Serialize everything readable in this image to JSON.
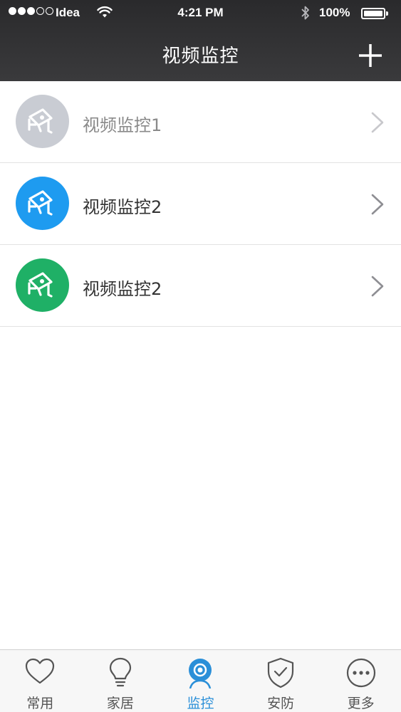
{
  "status_bar": {
    "carrier": "Idea",
    "time": "4:21 PM",
    "battery": "100%",
    "signal_bars_filled": 3,
    "signal_bars_total": 5
  },
  "nav": {
    "title": "视频监控",
    "add_icon": "plus-icon"
  },
  "cameras": [
    {
      "label": "视频监控1",
      "color": "#c9ccd3",
      "state": "inactive",
      "icon": "security-camera-icon"
    },
    {
      "label": "视频监控2",
      "color": "#1e9bf0",
      "state": "active",
      "icon": "security-camera-icon"
    },
    {
      "label": "视频监控2",
      "color": "#1fb066",
      "state": "active",
      "icon": "security-camera-icon"
    }
  ],
  "tabs": [
    {
      "label": "常用",
      "icon": "heart-icon",
      "active": false
    },
    {
      "label": "家居",
      "icon": "lightbulb-icon",
      "active": false
    },
    {
      "label": "监控",
      "icon": "webcam-icon",
      "active": true
    },
    {
      "label": "安防",
      "icon": "shield-check-icon",
      "active": false
    },
    {
      "label": "更多",
      "icon": "more-dots-icon",
      "active": false
    }
  ],
  "colors": {
    "header_bg": "#2f2f31",
    "active_tab": "#2a8fd8",
    "inactive_tab": "#555555"
  }
}
